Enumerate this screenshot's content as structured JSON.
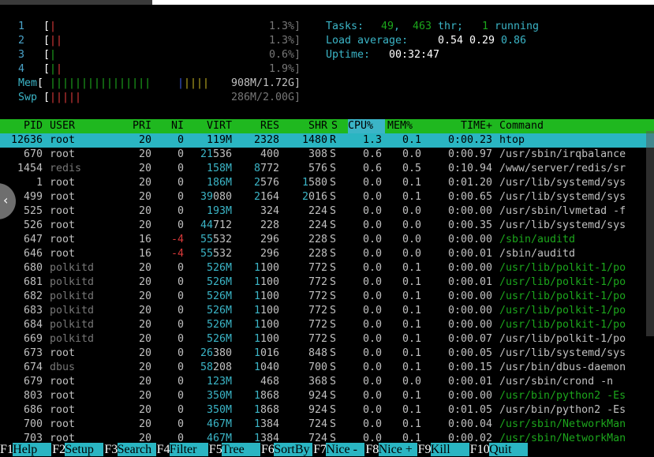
{
  "meters": {
    "cpus": [
      {
        "id": "1",
        "label": "1",
        "percent_text": "1.3%]",
        "bar": "|",
        "bar_colors": "r"
      },
      {
        "id": "2",
        "label": "2",
        "percent_text": "1.3%]",
        "bar": "||",
        "bar_colors": "rr"
      },
      {
        "id": "3",
        "label": "3",
        "percent_text": "0.6%]",
        "bar": "|",
        "bar_colors": "g"
      },
      {
        "id": "4",
        "label": "4",
        "percent_text": "1.9%]",
        "bar": "||",
        "bar_colors": "gr"
      }
    ],
    "mem": {
      "label": "Mem",
      "value_text": "908M/1.72G]",
      "bar_green": "||||||||||||||||",
      "bar_blue": "|",
      "bar_yellow": "||||"
    },
    "swp": {
      "label": "Swp",
      "value_text": "286M/2.00G]",
      "bar_red": "|||||"
    },
    "tasks": {
      "prefix": "Tasks: ",
      "tasks": "49",
      "sep": ", ",
      "threads": "463",
      "thr": " thr; ",
      "running": "1",
      "running_label": " running"
    },
    "load": {
      "prefix": "Load average: ",
      "l1": "0.54",
      "l5": "0.29",
      "l15": "0.86"
    },
    "uptime": {
      "prefix": "Uptime: ",
      "value": "00:32:47"
    }
  },
  "columns": [
    "PID",
    "USER",
    "PRI",
    "NI",
    "VIRT",
    "RES",
    "SHR",
    "S",
    "CPU%",
    "MEM%",
    "TIME+",
    "Command"
  ],
  "processes": [
    {
      "pid": "12636",
      "user": "root",
      "pri": "20",
      "ni": "0",
      "virt": "119M",
      "res": "2328",
      "shr": "1480",
      "s": "R",
      "cpu": "1.3",
      "mem": "0.1",
      "time": "0:00.23",
      "cmd": "htop",
      "selected": true
    },
    {
      "pid": "670",
      "user": "root",
      "pri": "20",
      "ni": "0",
      "virt": "21536",
      "res": "400",
      "shr": "308",
      "s": "S",
      "cpu": "0.6",
      "mem": "0.0",
      "time": "0:00.97",
      "cmd": "/usr/sbin/irqbalance"
    },
    {
      "pid": "1454",
      "user": "redis",
      "pri": "20",
      "ni": "0",
      "virt": "158M",
      "res": "8772",
      "shr": "576",
      "s": "S",
      "cpu": "0.6",
      "mem": "0.5",
      "time": "0:10.94",
      "cmd": "/www/server/redis/sr"
    },
    {
      "pid": "1",
      "user": "root",
      "pri": "20",
      "ni": "0",
      "virt": "186M",
      "res": "2576",
      "shr": "1580",
      "s": "S",
      "cpu": "0.0",
      "mem": "0.1",
      "time": "0:01.20",
      "cmd": "/usr/lib/systemd/sys"
    },
    {
      "pid": "499",
      "user": "root",
      "pri": "20",
      "ni": "0",
      "virt": "39080",
      "res": "2164",
      "shr": "2016",
      "s": "S",
      "cpu": "0.0",
      "mem": "0.1",
      "time": "0:00.65",
      "cmd": "/usr/lib/systemd/sys"
    },
    {
      "pid": "525",
      "user": "root",
      "pri": "20",
      "ni": "0",
      "virt": "193M",
      "res": "324",
      "shr": "224",
      "s": "S",
      "cpu": "0.0",
      "mem": "0.0",
      "time": "0:00.00",
      "cmd": "/usr/sbin/lvmetad -f"
    },
    {
      "pid": "526",
      "user": "root",
      "pri": "20",
      "ni": "0",
      "virt": "44712",
      "res": "228",
      "shr": "224",
      "s": "S",
      "cpu": "0.0",
      "mem": "0.0",
      "time": "0:00.35",
      "cmd": "/usr/lib/systemd/sys"
    },
    {
      "pid": "647",
      "user": "root",
      "pri": "16",
      "ni": "-4",
      "virt": "55532",
      "res": "296",
      "shr": "228",
      "s": "S",
      "cpu": "0.0",
      "mem": "0.0",
      "time": "0:00.00",
      "cmd": "/sbin/auditd",
      "thread": true
    },
    {
      "pid": "646",
      "user": "root",
      "pri": "16",
      "ni": "-4",
      "virt": "55532",
      "res": "296",
      "shr": "228",
      "s": "S",
      "cpu": "0.0",
      "mem": "0.0",
      "time": "0:00.01",
      "cmd": "/sbin/auditd"
    },
    {
      "pid": "680",
      "user": "polkitd",
      "pri": "20",
      "ni": "0",
      "virt": "526M",
      "res": "1100",
      "shr": "772",
      "s": "S",
      "cpu": "0.0",
      "mem": "0.1",
      "time": "0:00.00",
      "cmd": "/usr/lib/polkit-1/po",
      "thread": true
    },
    {
      "pid": "681",
      "user": "polkitd",
      "pri": "20",
      "ni": "0",
      "virt": "526M",
      "res": "1100",
      "shr": "772",
      "s": "S",
      "cpu": "0.0",
      "mem": "0.1",
      "time": "0:00.01",
      "cmd": "/usr/lib/polkit-1/po",
      "thread": true
    },
    {
      "pid": "682",
      "user": "polkitd",
      "pri": "20",
      "ni": "0",
      "virt": "526M",
      "res": "1100",
      "shr": "772",
      "s": "S",
      "cpu": "0.0",
      "mem": "0.1",
      "time": "0:00.00",
      "cmd": "/usr/lib/polkit-1/po",
      "thread": true
    },
    {
      "pid": "683",
      "user": "polkitd",
      "pri": "20",
      "ni": "0",
      "virt": "526M",
      "res": "1100",
      "shr": "772",
      "s": "S",
      "cpu": "0.0",
      "mem": "0.1",
      "time": "0:00.00",
      "cmd": "/usr/lib/polkit-1/po",
      "thread": true
    },
    {
      "pid": "684",
      "user": "polkitd",
      "pri": "20",
      "ni": "0",
      "virt": "526M",
      "res": "1100",
      "shr": "772",
      "s": "S",
      "cpu": "0.0",
      "mem": "0.1",
      "time": "0:00.00",
      "cmd": "/usr/lib/polkit-1/po",
      "thread": true
    },
    {
      "pid": "669",
      "user": "polkitd",
      "pri": "20",
      "ni": "0",
      "virt": "526M",
      "res": "1100",
      "shr": "772",
      "s": "S",
      "cpu": "0.0",
      "mem": "0.1",
      "time": "0:00.07",
      "cmd": "/usr/lib/polkit-1/po"
    },
    {
      "pid": "673",
      "user": "root",
      "pri": "20",
      "ni": "0",
      "virt": "26380",
      "res": "1016",
      "shr": "848",
      "s": "S",
      "cpu": "0.0",
      "mem": "0.1",
      "time": "0:00.05",
      "cmd": "/usr/lib/systemd/sys"
    },
    {
      "pid": "674",
      "user": "dbus",
      "pri": "20",
      "ni": "0",
      "virt": "58208",
      "res": "1040",
      "shr": "700",
      "s": "S",
      "cpu": "0.0",
      "mem": "0.1",
      "time": "0:00.15",
      "cmd": "/usr/bin/dbus-daemon"
    },
    {
      "pid": "679",
      "user": "root",
      "pri": "20",
      "ni": "0",
      "virt": "123M",
      "res": "468",
      "shr": "368",
      "s": "S",
      "cpu": "0.0",
      "mem": "0.0",
      "time": "0:00.01",
      "cmd": "/usr/sbin/crond -n"
    },
    {
      "pid": "803",
      "user": "root",
      "pri": "20",
      "ni": "0",
      "virt": "350M",
      "res": "1868",
      "shr": "924",
      "s": "S",
      "cpu": "0.0",
      "mem": "0.1",
      "time": "0:00.00",
      "cmd": "/usr/bin/python2 -Es",
      "thread": true
    },
    {
      "pid": "686",
      "user": "root",
      "pri": "20",
      "ni": "0",
      "virt": "350M",
      "res": "1868",
      "shr": "924",
      "s": "S",
      "cpu": "0.0",
      "mem": "0.1",
      "time": "0:01.05",
      "cmd": "/usr/bin/python2 -Es"
    },
    {
      "pid": "700",
      "user": "root",
      "pri": "20",
      "ni": "0",
      "virt": "467M",
      "res": "1384",
      "shr": "724",
      "s": "S",
      "cpu": "0.0",
      "mem": "0.1",
      "time": "0:00.04",
      "cmd": "/usr/sbin/NetworkMan",
      "thread": true
    },
    {
      "pid": "703",
      "user": "root",
      "pri": "20",
      "ni": "0",
      "virt": "467M",
      "res": "1384",
      "shr": "724",
      "s": "S",
      "cpu": "0.0",
      "mem": "0.1",
      "time": "0:00.02",
      "cmd": "/usr/sbin/NetworkMan",
      "thread": true
    }
  ],
  "footer": [
    {
      "key": "F1",
      "label": "Help  "
    },
    {
      "key": "F2",
      "label": "Setup "
    },
    {
      "key": "F3",
      "label": "Search"
    },
    {
      "key": "F4",
      "label": "Filter"
    },
    {
      "key": "F5",
      "label": "Tree  "
    },
    {
      "key": "F6",
      "label": "SortBy"
    },
    {
      "key": "F7",
      "label": "Nice -"
    },
    {
      "key": "F8",
      "label": "Nice +"
    },
    {
      "key": "F9",
      "label": "Kill  "
    },
    {
      "key": "F10",
      "label": "Quit  "
    }
  ],
  "colors": {
    "header_bg": "#1fb81f",
    "selected_bg": "#2ab5c2",
    "cyan": "#3bb5c7",
    "green": "#1ca61c",
    "red": "#d83a3a"
  }
}
